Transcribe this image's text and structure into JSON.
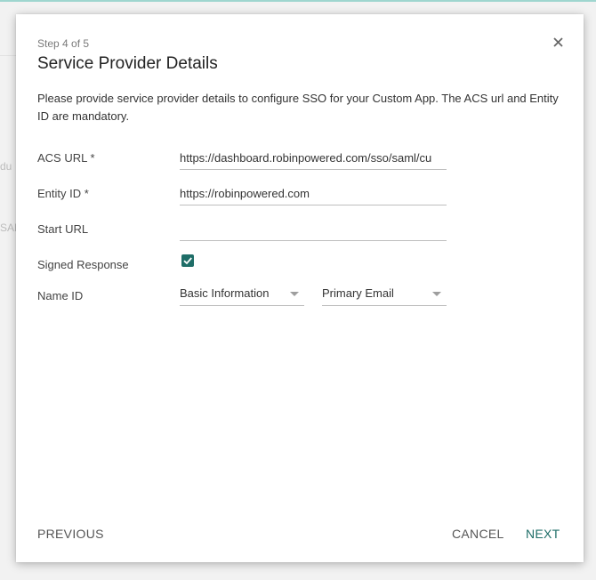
{
  "background": {
    "fragment_1": "du",
    "fragment_2": "SAN"
  },
  "dialog": {
    "step": "Step 4 of 5",
    "title": "Service Provider Details",
    "description": "Please provide service provider details to configure SSO for your Custom App. The ACS url and Entity ID are mandatory.",
    "close_icon": "close-icon"
  },
  "form": {
    "acs_url": {
      "label": "ACS URL *",
      "value": "https://dashboard.robinpowered.com/sso/saml/cu"
    },
    "entity_id": {
      "label": "Entity ID *",
      "value": "https://robinpowered.com"
    },
    "start_url": {
      "label": "Start URL",
      "value": ""
    },
    "signed_response": {
      "label": "Signed Response",
      "checked": true
    },
    "name_id": {
      "label": "Name ID",
      "category_selected": "Basic Information",
      "attribute_selected": "Primary Email"
    }
  },
  "footer": {
    "previous_label": "PREVIOUS",
    "cancel_label": "CANCEL",
    "next_label": "NEXT"
  },
  "colors": {
    "accent": "#1f6e68",
    "underline": "#bdbdbd"
  }
}
